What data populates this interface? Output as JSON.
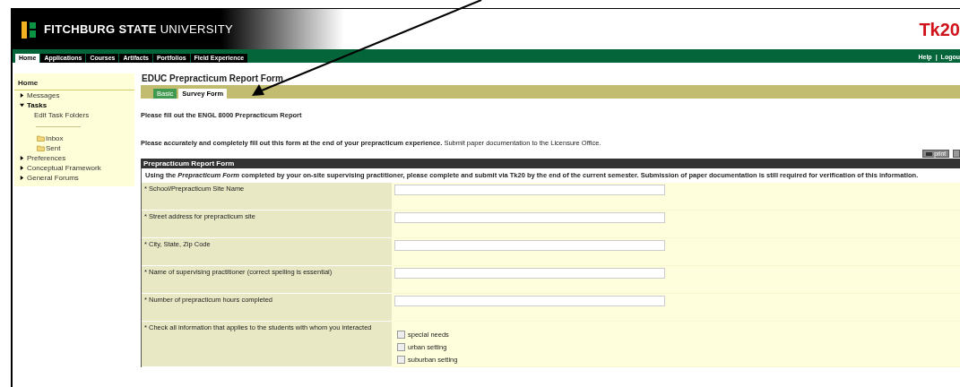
{
  "header": {
    "university_name": "FITCHBURG STATE",
    "university_suffix": "UNIVERSITY",
    "brand_logo": "Tk20"
  },
  "nav": {
    "tabs": [
      {
        "label": "Home",
        "selected": true
      },
      {
        "label": "Applications",
        "selected": false
      },
      {
        "label": "Courses",
        "selected": false
      },
      {
        "label": "Artifacts",
        "selected": false
      },
      {
        "label": "Portfolios",
        "selected": false
      },
      {
        "label": "Field Experience",
        "selected": false
      }
    ],
    "links": [
      "Help",
      "Logou"
    ],
    "separator": "|"
  },
  "sidebar": {
    "title": "Home",
    "items": [
      {
        "label": "Messages",
        "expanded": false
      },
      {
        "label": "Tasks",
        "expanded": true,
        "children": [
          {
            "label": "Edit Task Folders",
            "kind": "link"
          },
          {
            "label": "Inbox",
            "kind": "folder"
          },
          {
            "label": "Sent",
            "kind": "folder"
          }
        ]
      },
      {
        "label": "Preferences",
        "expanded": false
      },
      {
        "label": "Conceptual Framework",
        "expanded": false
      },
      {
        "label": "General Forums",
        "expanded": false
      }
    ]
  },
  "page_title": "EDUC Prepracticum Report Form",
  "form_tabs": [
    {
      "label": "Basic",
      "selected": false
    },
    {
      "label": "Survey Form",
      "selected": true
    }
  ],
  "intro": "Please fill out the ENGL 8000 Prepracticum Report",
  "instruction": "**Please accurately and completely fill out this form at the end of your prepracticum experience.** Submit paper documentation to the Licensure Office.",
  "print_button": "print",
  "section": {
    "title": "Prepracticum Report Form",
    "note": "Using the *Prepracticum Form* completed by your on-site supervising practitioner, please complete and submit via Tk20 by the end of the current semester. Submission of paper documentation is still required for verification of this information.",
    "fields": [
      {
        "label": "* School/Prepracticum Site Name",
        "kind": "text"
      },
      {
        "label": "* Street address for prepracticum site",
        "kind": "text"
      },
      {
        "label": "* City, State, Zip Code",
        "kind": "text"
      },
      {
        "label": "* Name of supervising practitioner (correct spelling is essential)",
        "kind": "text"
      },
      {
        "label": "* Number of prepracticum hours completed",
        "kind": "text"
      },
      {
        "label": "* Check all information that applies to the students with whom you interacted",
        "kind": "checkboxes",
        "options": [
          {
            "label": "special needs",
            "checked": false
          },
          {
            "label": "urban setting",
            "checked": false
          },
          {
            "label": "suburban setting",
            "checked": false
          }
        ]
      }
    ]
  }
}
